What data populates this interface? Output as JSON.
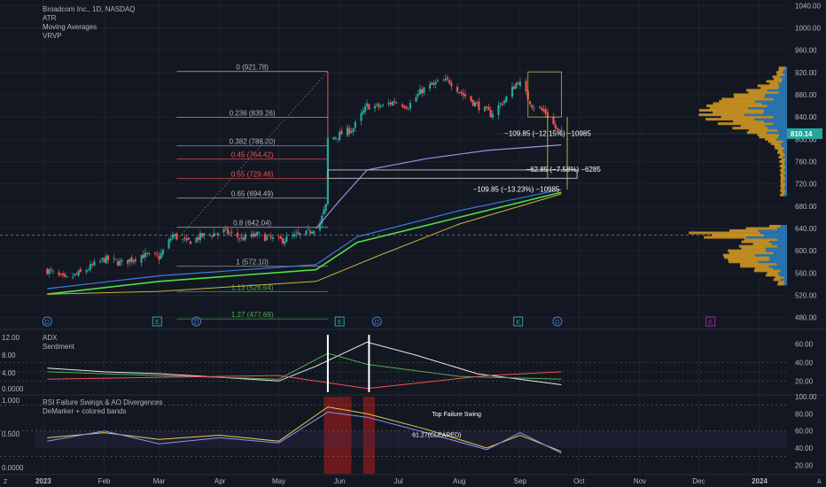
{
  "legend": {
    "symbol": "Broadcom Inc., 1D, NASDAQ",
    "indicators": [
      "ATR",
      "Moving Averages",
      "VRVP"
    ]
  },
  "panels": {
    "adx_labels": [
      "ADX",
      "Sentiment"
    ],
    "rsi_labels": [
      "RSI Failure Swings & AO Divergences",
      "DeMarker + colored bands"
    ]
  },
  "colors": {
    "background": "#131722",
    "up": "#26a69a",
    "down": "#ef5350",
    "grid": "#1e222d",
    "ma_blue": "#3d7bd9",
    "ma_green": "#4ee044",
    "ma_yellow": "#c9b63a",
    "ma_purple": "#9b8ee6",
    "price_tag": "#26a69a",
    "vrvp_up": "#2d7fc1",
    "vrvp_down": "#d79b22"
  },
  "chart_data": [
    {
      "type": "candlestick",
      "title": "Broadcom Inc., 1D, NASDAQ",
      "x_ticks": [
        "2023",
        "Feb",
        "Mar",
        "Apr",
        "May",
        "Jun",
        "Jul",
        "Aug",
        "Sep",
        "Oct",
        "Nov",
        "Dec",
        "2024"
      ],
      "y_ticks": [
        480,
        520,
        560,
        600,
        640,
        680,
        720,
        760,
        800,
        840,
        880,
        920,
        960,
        1000,
        1040
      ],
      "ylim": [
        462,
        1050
      ],
      "last_price": "810.14",
      "close_path": [
        {
          "date": "2023-01-03",
          "close": 565
        },
        {
          "date": "2023-01-12",
          "close": 548
        },
        {
          "date": "2023-01-20",
          "close": 560
        },
        {
          "date": "2023-02-01",
          "close": 585
        },
        {
          "date": "2023-02-10",
          "close": 578
        },
        {
          "date": "2023-02-20",
          "close": 592
        },
        {
          "date": "2023-03-01",
          "close": 588
        },
        {
          "date": "2023-03-08",
          "close": 628
        },
        {
          "date": "2023-03-15",
          "close": 615
        },
        {
          "date": "2023-03-22",
          "close": 625
        },
        {
          "date": "2023-04-03",
          "close": 635
        },
        {
          "date": "2023-04-12",
          "close": 622
        },
        {
          "date": "2023-04-20",
          "close": 628
        },
        {
          "date": "2023-05-01",
          "close": 618
        },
        {
          "date": "2023-05-08",
          "close": 625
        },
        {
          "date": "2023-05-15",
          "close": 630
        },
        {
          "date": "2023-05-22",
          "close": 650
        },
        {
          "date": "2023-05-25",
          "close": 680
        },
        {
          "date": "2023-05-26",
          "close": 800
        },
        {
          "date": "2023-06-01",
          "close": 808
        },
        {
          "date": "2023-06-08",
          "close": 820
        },
        {
          "date": "2023-06-15",
          "close": 860
        },
        {
          "date": "2023-06-22",
          "close": 858
        },
        {
          "date": "2023-06-29",
          "close": 868
        },
        {
          "date": "2023-07-06",
          "close": 860
        },
        {
          "date": "2023-07-13",
          "close": 888
        },
        {
          "date": "2023-07-20",
          "close": 900
        },
        {
          "date": "2023-07-27",
          "close": 905
        },
        {
          "date": "2023-08-03",
          "close": 880
        },
        {
          "date": "2023-08-10",
          "close": 862
        },
        {
          "date": "2023-08-17",
          "close": 845
        },
        {
          "date": "2023-08-24",
          "close": 870
        },
        {
          "date": "2023-08-31",
          "close": 905
        },
        {
          "date": "2023-09-07",
          "close": 862
        },
        {
          "date": "2023-09-14",
          "close": 848
        },
        {
          "date": "2023-09-20",
          "close": 815
        },
        {
          "date": "2023-09-22",
          "close": 810
        }
      ],
      "fib_levels": [
        {
          "ratio": "0",
          "price": 921.78,
          "label": "0 (921.78)",
          "color": "#b2b5be"
        },
        {
          "ratio": "0.236",
          "price": 839.26,
          "label": "0.236 (839.26)",
          "color": "#b2b5be"
        },
        {
          "ratio": "0.382",
          "price": 788.2,
          "label": "0.382 (788.20)",
          "color": "#b2b5be"
        },
        {
          "ratio": "0.45",
          "price": 764.42,
          "label": "0.45 (764.42)",
          "color": "#ef5350"
        },
        {
          "ratio": "0.55",
          "price": 729.46,
          "label": "0.55 (729.46)",
          "color": "#ef5350"
        },
        {
          "ratio": "0.65",
          "price": 694.49,
          "label": "0.65 (694.49)",
          "color": "#b2b5be"
        },
        {
          "ratio": "0.8",
          "price": 642.04,
          "label": "0.8 (642.04)",
          "color": "#b2b5be"
        },
        {
          "ratio": "1",
          "price": 572.1,
          "label": "1 (572.10)",
          "color": "#b2b5be"
        },
        {
          "ratio": "1.13",
          "price": 526.64,
          "label": "1.13 (526.64)",
          "color": "#4caf50"
        },
        {
          "ratio": "1.27",
          "price": 477.69,
          "label": "1.27 (477.69)",
          "color": "#4caf50"
        }
      ],
      "annotations": [
        "−109.85 (−12.15%) −10985",
        "−62.85 (−7.58%) −6285",
        "−109.85 (−13.23%) −10985"
      ],
      "moving_averages": {
        "ma_blue": [
          {
            "date": "2023-01-03",
            "v": 532
          },
          {
            "date": "2023-03-01",
            "v": 555
          },
          {
            "date": "2023-05-20",
            "v": 575
          },
          {
            "date": "2023-06-10",
            "v": 625
          },
          {
            "date": "2023-08-01",
            "v": 672
          },
          {
            "date": "2023-09-22",
            "v": 710
          }
        ],
        "ma_green": [
          {
            "date": "2023-01-03",
            "v": 522
          },
          {
            "date": "2023-03-01",
            "v": 545
          },
          {
            "date": "2023-05-20",
            "v": 566
          },
          {
            "date": "2023-06-10",
            "v": 615
          },
          {
            "date": "2023-08-01",
            "v": 660
          },
          {
            "date": "2023-09-22",
            "v": 705
          }
        ],
        "ma_yellow": [
          {
            "date": "2023-01-03",
            "v": 522
          },
          {
            "date": "2023-03-01",
            "v": 527
          },
          {
            "date": "2023-05-20",
            "v": 545
          },
          {
            "date": "2023-06-20",
            "v": 590
          },
          {
            "date": "2023-08-01",
            "v": 648
          },
          {
            "date": "2023-09-22",
            "v": 702
          }
        ],
        "ma_purple": [
          {
            "date": "2023-05-20",
            "v": 640
          },
          {
            "date": "2023-06-01",
            "v": 690
          },
          {
            "date": "2023-06-15",
            "v": 745
          },
          {
            "date": "2023-07-15",
            "v": 765
          },
          {
            "date": "2023-08-15",
            "v": 780
          },
          {
            "date": "2023-09-22",
            "v": 790
          }
        ]
      },
      "event_markers": [
        {
          "date": "2023-01-03",
          "label": "D",
          "color": "#3d7bd9"
        },
        {
          "date": "2023-02-28",
          "label": "E",
          "color": "#26a69a"
        },
        {
          "date": "2023-03-20",
          "label": "D",
          "color": "#3d7bd9"
        },
        {
          "date": "2023-06-01",
          "label": "E",
          "color": "#26a69a"
        },
        {
          "date": "2023-06-20",
          "label": "D",
          "color": "#3d7bd9"
        },
        {
          "date": "2023-08-31",
          "label": "E",
          "color": "#26a69a"
        },
        {
          "date": "2023-09-20",
          "label": "D",
          "color": "#3d7bd9"
        },
        {
          "date": "2023-12-07",
          "label": "E",
          "color": "#9c27b0"
        }
      ]
    },
    {
      "type": "line",
      "title": "ADX",
      "y_ticks": [
        "60.00",
        "40.00",
        "20.00"
      ],
      "left_ticks": [
        "12.00",
        "8.00",
        "4.00",
        "0.0000"
      ],
      "ylim": [
        5,
        72
      ],
      "series": [
        {
          "name": "ADX",
          "color": "#e8e8e8",
          "points": [
            {
              "date": "2023-01-03",
              "v": 34
            },
            {
              "date": "2023-02-01",
              "v": 30
            },
            {
              "date": "2023-03-01",
              "v": 28
            },
            {
              "date": "2023-04-01",
              "v": 24
            },
            {
              "date": "2023-05-01",
              "v": 20
            },
            {
              "date": "2023-05-20",
              "v": 36
            },
            {
              "date": "2023-06-15",
              "v": 62
            },
            {
              "date": "2023-07-10",
              "v": 48
            },
            {
              "date": "2023-08-10",
              "v": 28
            },
            {
              "date": "2023-09-22",
              "v": 16
            }
          ]
        },
        {
          "name": "",
          "color": "#4caf50",
          "points": [
            {
              "date": "2023-01-03",
              "v": 30
            },
            {
              "date": "2023-03-01",
              "v": 26
            },
            {
              "date": "2023-05-01",
              "v": 22
            },
            {
              "date": "2023-05-26",
              "v": 50
            },
            {
              "date": "2023-06-15",
              "v": 38
            },
            {
              "date": "2023-08-01",
              "v": 25
            },
            {
              "date": "2023-09-22",
              "v": 22
            }
          ]
        },
        {
          "name": "",
          "color": "#ef5350",
          "points": [
            {
              "date": "2023-01-03",
              "v": 22
            },
            {
              "date": "2023-03-01",
              "v": 24
            },
            {
              "date": "2023-05-01",
              "v": 26
            },
            {
              "date": "2023-06-15",
              "v": 12
            },
            {
              "date": "2023-08-15",
              "v": 26
            },
            {
              "date": "2023-09-22",
              "v": 30
            }
          ]
        }
      ]
    },
    {
      "type": "line",
      "title": "RSI Failure Swings & AO Divergences",
      "y_ticks": [
        "100.00",
        "80.00",
        "60.00",
        "40.00",
        "20.00"
      ],
      "left_ticks": [
        "1.000",
        "0.500",
        "0.0000"
      ],
      "ylim": [
        10,
        100
      ],
      "annotations": [
        "Top Failure Swing",
        "61.27(CLEARED)"
      ],
      "shaded_ranges": [
        [
          "2023-05-24",
          "2023-06-07"
        ],
        [
          "2023-06-13",
          "2023-06-19"
        ]
      ],
      "series": [
        {
          "name": "RSI",
          "color": "#e8c84a",
          "points": [
            {
              "date": "2023-01-03",
              "v": 52
            },
            {
              "date": "2023-02-01",
              "v": 58
            },
            {
              "date": "2023-03-01",
              "v": 50
            },
            {
              "date": "2023-04-01",
              "v": 55
            },
            {
              "date": "2023-05-01",
              "v": 48
            },
            {
              "date": "2023-05-26",
              "v": 88
            },
            {
              "date": "2023-06-15",
              "v": 80
            },
            {
              "date": "2023-07-15",
              "v": 62
            },
            {
              "date": "2023-08-15",
              "v": 40
            },
            {
              "date": "2023-09-01",
              "v": 55
            },
            {
              "date": "2023-09-22",
              "v": 36
            }
          ]
        },
        {
          "name": "DeMarker",
          "color": "#7b9cf0",
          "points": [
            {
              "date": "2023-01-03",
              "v": 48
            },
            {
              "date": "2023-02-01",
              "v": 60
            },
            {
              "date": "2023-03-01",
              "v": 45
            },
            {
              "date": "2023-04-01",
              "v": 52
            },
            {
              "date": "2023-05-01",
              "v": 46
            },
            {
              "date": "2023-05-26",
              "v": 82
            },
            {
              "date": "2023-06-15",
              "v": 76
            },
            {
              "date": "2023-07-15",
              "v": 58
            },
            {
              "date": "2023-08-15",
              "v": 38
            },
            {
              "date": "2023-09-01",
              "v": 58
            },
            {
              "date": "2023-09-22",
              "v": 34
            }
          ]
        }
      ]
    }
  ]
}
